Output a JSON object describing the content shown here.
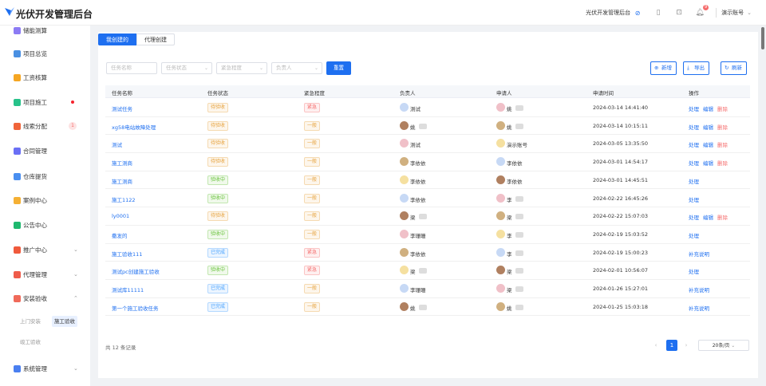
{
  "app": {
    "title": "光伏开发管理后台"
  },
  "header": {
    "system_name": "光伏开发管理后台",
    "notification_count": "9",
    "user_name": "演示账号"
  },
  "sidebar": {
    "items": [
      {
        "label": "储能测算",
        "color": "#8c7bf4"
      },
      {
        "label": "项目总览",
        "color": "#4a90e2"
      },
      {
        "label": "工资核算",
        "color": "#f5a623"
      },
      {
        "label": "项目施工",
        "color": "#27c28a",
        "dot": true
      },
      {
        "label": "线索分配",
        "color": "#f0643a",
        "badge": "1"
      },
      {
        "label": "合同管理",
        "color": "#6a6ff5"
      },
      {
        "label": "仓库提货",
        "color": "#4a8ff0"
      },
      {
        "label": "案例中心",
        "color": "#f5b034"
      },
      {
        "label": "公告中心",
        "color": "#1fb86f"
      },
      {
        "label": "推广中心",
        "color": "#f05a3c",
        "chev": "⌄"
      },
      {
        "label": "代理管理",
        "color": "#ef5c4b",
        "chev": "⌄"
      },
      {
        "label": "安装验收",
        "color": "#f06a5a",
        "chev": "⌃"
      },
      {
        "label": "系统管理",
        "color": "#4a7ff0",
        "chev": "⌄"
      }
    ],
    "sub_items": [
      "上门安装",
      "施工验收",
      "竣工验收"
    ]
  },
  "tabs": [
    "我创建的",
    "代理创建"
  ],
  "filters": {
    "task_name": "任务名称",
    "task_status": "任务状态",
    "urgency": "紧急程度",
    "owner": "负责人",
    "reset": "重置"
  },
  "actions": {
    "add": "新增",
    "export": "导出",
    "refresh": "刷新"
  },
  "table": {
    "columns": [
      "任务名称",
      "任务状态",
      "紧急程度",
      "负责人",
      "申请人",
      "申请时间",
      "操作"
    ],
    "rows": [
      {
        "name": "测试任务",
        "status": "待验收",
        "urgency": "紧急",
        "owner": "测试",
        "applicant": "姚",
        "time": "2024-03-14 14:41:40",
        "ops": [
          "处理",
          "编辑",
          "删除"
        ]
      },
      {
        "name": "xg58电站故障处理",
        "status": "待验收",
        "urgency": "一般",
        "owner": "姚",
        "applicant": "姚",
        "time": "2024-03-14 10:15:11",
        "ops": [
          "处理",
          "编辑",
          "删除"
        ]
      },
      {
        "name": "测试",
        "status": "待验收",
        "urgency": "一般",
        "owner": "测试",
        "applicant": "演示账号",
        "time": "2024-03-05 13:35:50",
        "ops": [
          "处理",
          "编辑",
          "删除"
        ]
      },
      {
        "name": "施工测商",
        "status": "待验收",
        "urgency": "一般",
        "owner": "李依依",
        "applicant": "李依依",
        "time": "2024-03-01 14:54:17",
        "ops": [
          "处理",
          "编辑",
          "删除"
        ]
      },
      {
        "name": "施工测商",
        "status": "验收中",
        "urgency": "一般",
        "owner": "李依依",
        "applicant": "李依依",
        "time": "2024-03-01 14:45:51",
        "ops": [
          "处理"
        ]
      },
      {
        "name": "施工1122",
        "status": "验收中",
        "urgency": "一般",
        "owner": "李依依",
        "applicant": "李",
        "time": "2024-02-22 16:45:26",
        "ops": [
          "处理"
        ]
      },
      {
        "name": "ly0001",
        "status": "待验收",
        "urgency": "一般",
        "owner": "梁",
        "applicant": "梁",
        "time": "2024-02-22 15:07:03",
        "ops": [
          "处理",
          "编辑",
          "删除"
        ]
      },
      {
        "name": "撒发的",
        "status": "验收中",
        "urgency": "一般",
        "owner": "李珊珊",
        "applicant": "李",
        "time": "2024-02-19 15:03:52",
        "ops": [
          "处理"
        ]
      },
      {
        "name": "施工验收111",
        "status": "已完成",
        "urgency": "紧急",
        "owner": "李依依",
        "applicant": "李",
        "time": "2024-02-19 15:00:23",
        "ops": [
          "补充说明"
        ]
      },
      {
        "name": "测试pc创建施工验收",
        "status": "验收中",
        "urgency": "紧急",
        "owner": "梁",
        "applicant": "梁",
        "time": "2024-02-01 10:56:07",
        "ops": [
          "处理"
        ]
      },
      {
        "name": "测试库11111",
        "status": "已完成",
        "urgency": "一般",
        "owner": "李珊珊",
        "applicant": "梁",
        "time": "2024-01-26 15:27:01",
        "ops": [
          "补充说明"
        ]
      },
      {
        "name": "第一个施工验收任务",
        "status": "已完成",
        "urgency": "一般",
        "owner": "姚",
        "applicant": "姚",
        "time": "2024-01-25 15:03:18",
        "ops": [
          "补充说明"
        ]
      }
    ]
  },
  "pagination": {
    "total": "共 12 条记录",
    "page": "1",
    "page_size": "20条/页"
  },
  "colors": {
    "primary": "#1e6ff0",
    "danger": "#f56c6c",
    "warning": "#e6a23c",
    "success": "#67c23a"
  }
}
